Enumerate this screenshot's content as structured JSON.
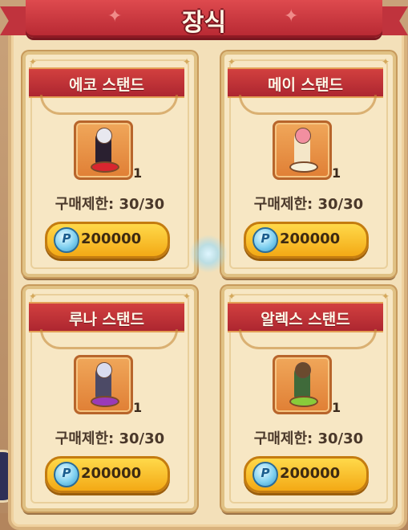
{
  "title": "장식",
  "items": [
    {
      "name": "에코 스탠드",
      "quantity": "1",
      "limit": "구매제한: 30/30",
      "price": "200000",
      "currency_icon": "P"
    },
    {
      "name": "메이 스탠드",
      "quantity": "1",
      "limit": "구매제한: 30/30",
      "price": "200000",
      "currency_icon": "P"
    },
    {
      "name": "루나 스탠드",
      "quantity": "1",
      "limit": "구매제한: 30/30",
      "price": "200000",
      "currency_icon": "P"
    },
    {
      "name": "알렉스 스탠드",
      "quantity": "1",
      "limit": "구매제한: 30/30",
      "price": "200000",
      "currency_icon": "P"
    }
  ],
  "colors": {
    "ribbon": "#c0333d",
    "card_bg": "#f7e7c4",
    "button": "#f3a915",
    "currency": "#7fd0f0"
  }
}
